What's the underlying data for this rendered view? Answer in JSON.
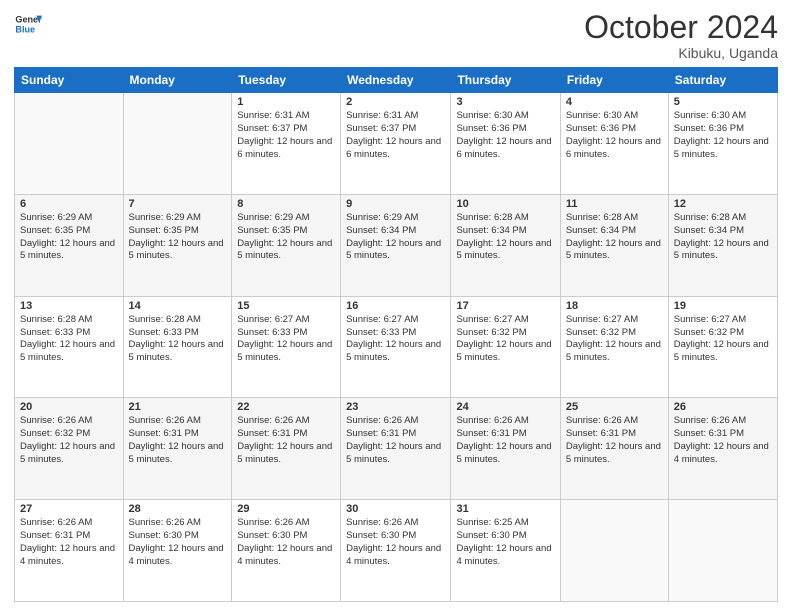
{
  "logo": {
    "line1": "General",
    "line2": "Blue"
  },
  "title": "October 2024",
  "location": "Kibuku, Uganda",
  "days_header": [
    "Sunday",
    "Monday",
    "Tuesday",
    "Wednesday",
    "Thursday",
    "Friday",
    "Saturday"
  ],
  "weeks": [
    [
      {
        "num": "",
        "sunrise": "",
        "sunset": "",
        "daylight": ""
      },
      {
        "num": "",
        "sunrise": "",
        "sunset": "",
        "daylight": ""
      },
      {
        "num": "1",
        "sunrise": "Sunrise: 6:31 AM",
        "sunset": "Sunset: 6:37 PM",
        "daylight": "Daylight: 12 hours and 6 minutes."
      },
      {
        "num": "2",
        "sunrise": "Sunrise: 6:31 AM",
        "sunset": "Sunset: 6:37 PM",
        "daylight": "Daylight: 12 hours and 6 minutes."
      },
      {
        "num": "3",
        "sunrise": "Sunrise: 6:30 AM",
        "sunset": "Sunset: 6:36 PM",
        "daylight": "Daylight: 12 hours and 6 minutes."
      },
      {
        "num": "4",
        "sunrise": "Sunrise: 6:30 AM",
        "sunset": "Sunset: 6:36 PM",
        "daylight": "Daylight: 12 hours and 6 minutes."
      },
      {
        "num": "5",
        "sunrise": "Sunrise: 6:30 AM",
        "sunset": "Sunset: 6:36 PM",
        "daylight": "Daylight: 12 hours and 5 minutes."
      }
    ],
    [
      {
        "num": "6",
        "sunrise": "Sunrise: 6:29 AM",
        "sunset": "Sunset: 6:35 PM",
        "daylight": "Daylight: 12 hours and 5 minutes."
      },
      {
        "num": "7",
        "sunrise": "Sunrise: 6:29 AM",
        "sunset": "Sunset: 6:35 PM",
        "daylight": "Daylight: 12 hours and 5 minutes."
      },
      {
        "num": "8",
        "sunrise": "Sunrise: 6:29 AM",
        "sunset": "Sunset: 6:35 PM",
        "daylight": "Daylight: 12 hours and 5 minutes."
      },
      {
        "num": "9",
        "sunrise": "Sunrise: 6:29 AM",
        "sunset": "Sunset: 6:34 PM",
        "daylight": "Daylight: 12 hours and 5 minutes."
      },
      {
        "num": "10",
        "sunrise": "Sunrise: 6:28 AM",
        "sunset": "Sunset: 6:34 PM",
        "daylight": "Daylight: 12 hours and 5 minutes."
      },
      {
        "num": "11",
        "sunrise": "Sunrise: 6:28 AM",
        "sunset": "Sunset: 6:34 PM",
        "daylight": "Daylight: 12 hours and 5 minutes."
      },
      {
        "num": "12",
        "sunrise": "Sunrise: 6:28 AM",
        "sunset": "Sunset: 6:34 PM",
        "daylight": "Daylight: 12 hours and 5 minutes."
      }
    ],
    [
      {
        "num": "13",
        "sunrise": "Sunrise: 6:28 AM",
        "sunset": "Sunset: 6:33 PM",
        "daylight": "Daylight: 12 hours and 5 minutes."
      },
      {
        "num": "14",
        "sunrise": "Sunrise: 6:28 AM",
        "sunset": "Sunset: 6:33 PM",
        "daylight": "Daylight: 12 hours and 5 minutes."
      },
      {
        "num": "15",
        "sunrise": "Sunrise: 6:27 AM",
        "sunset": "Sunset: 6:33 PM",
        "daylight": "Daylight: 12 hours and 5 minutes."
      },
      {
        "num": "16",
        "sunrise": "Sunrise: 6:27 AM",
        "sunset": "Sunset: 6:33 PM",
        "daylight": "Daylight: 12 hours and 5 minutes."
      },
      {
        "num": "17",
        "sunrise": "Sunrise: 6:27 AM",
        "sunset": "Sunset: 6:32 PM",
        "daylight": "Daylight: 12 hours and 5 minutes."
      },
      {
        "num": "18",
        "sunrise": "Sunrise: 6:27 AM",
        "sunset": "Sunset: 6:32 PM",
        "daylight": "Daylight: 12 hours and 5 minutes."
      },
      {
        "num": "19",
        "sunrise": "Sunrise: 6:27 AM",
        "sunset": "Sunset: 6:32 PM",
        "daylight": "Daylight: 12 hours and 5 minutes."
      }
    ],
    [
      {
        "num": "20",
        "sunrise": "Sunrise: 6:26 AM",
        "sunset": "Sunset: 6:32 PM",
        "daylight": "Daylight: 12 hours and 5 minutes."
      },
      {
        "num": "21",
        "sunrise": "Sunrise: 6:26 AM",
        "sunset": "Sunset: 6:31 PM",
        "daylight": "Daylight: 12 hours and 5 minutes."
      },
      {
        "num": "22",
        "sunrise": "Sunrise: 6:26 AM",
        "sunset": "Sunset: 6:31 PM",
        "daylight": "Daylight: 12 hours and 5 minutes."
      },
      {
        "num": "23",
        "sunrise": "Sunrise: 6:26 AM",
        "sunset": "Sunset: 6:31 PM",
        "daylight": "Daylight: 12 hours and 5 minutes."
      },
      {
        "num": "24",
        "sunrise": "Sunrise: 6:26 AM",
        "sunset": "Sunset: 6:31 PM",
        "daylight": "Daylight: 12 hours and 5 minutes."
      },
      {
        "num": "25",
        "sunrise": "Sunrise: 6:26 AM",
        "sunset": "Sunset: 6:31 PM",
        "daylight": "Daylight: 12 hours and 5 minutes."
      },
      {
        "num": "26",
        "sunrise": "Sunrise: 6:26 AM",
        "sunset": "Sunset: 6:31 PM",
        "daylight": "Daylight: 12 hours and 4 minutes."
      }
    ],
    [
      {
        "num": "27",
        "sunrise": "Sunrise: 6:26 AM",
        "sunset": "Sunset: 6:31 PM",
        "daylight": "Daylight: 12 hours and 4 minutes."
      },
      {
        "num": "28",
        "sunrise": "Sunrise: 6:26 AM",
        "sunset": "Sunset: 6:30 PM",
        "daylight": "Daylight: 12 hours and 4 minutes."
      },
      {
        "num": "29",
        "sunrise": "Sunrise: 6:26 AM",
        "sunset": "Sunset: 6:30 PM",
        "daylight": "Daylight: 12 hours and 4 minutes."
      },
      {
        "num": "30",
        "sunrise": "Sunrise: 6:26 AM",
        "sunset": "Sunset: 6:30 PM",
        "daylight": "Daylight: 12 hours and 4 minutes."
      },
      {
        "num": "31",
        "sunrise": "Sunrise: 6:25 AM",
        "sunset": "Sunset: 6:30 PM",
        "daylight": "Daylight: 12 hours and 4 minutes."
      },
      {
        "num": "",
        "sunrise": "",
        "sunset": "",
        "daylight": ""
      },
      {
        "num": "",
        "sunrise": "",
        "sunset": "",
        "daylight": ""
      }
    ]
  ]
}
